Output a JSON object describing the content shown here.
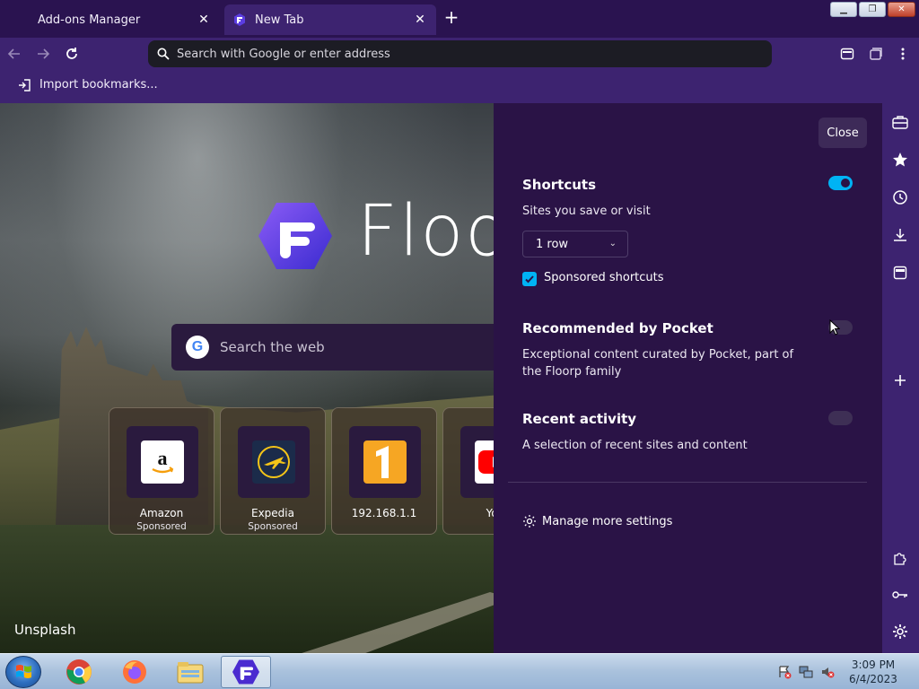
{
  "tabs": [
    {
      "label": "Add-ons Manager",
      "active": false
    },
    {
      "label": "New Tab",
      "active": true
    }
  ],
  "window_controls": {
    "minimize": "minimize-icon",
    "maximize": "restore-icon",
    "close": "close-icon"
  },
  "navbar": {
    "url_placeholder": "Search with Google or enter address"
  },
  "bookmarks": {
    "import_label": "Import bookmarks..."
  },
  "newtab": {
    "brand": "Floorp",
    "search_placeholder": "Search the web",
    "shortcuts": [
      {
        "title": "Amazon",
        "sub": "Sponsored",
        "icon": "amazon-icon",
        "color": "#ffffff"
      },
      {
        "title": "Expedia",
        "sub": "Sponsored",
        "icon": "expedia-icon",
        "color": "#1b2b4a"
      },
      {
        "title": "192.168.1.1",
        "sub": "",
        "icon": "number-one-icon",
        "color": "#f6a623"
      },
      {
        "title": "You",
        "sub": "",
        "icon": "youtube-icon",
        "color": "#ff0000"
      }
    ],
    "photo_credit": "Unsplash"
  },
  "panel": {
    "close_label": "Close",
    "shortcuts": {
      "title": "Shortcuts",
      "desc": "Sites you save or visit",
      "enabled": true,
      "rows_selected": "1 row",
      "sponsored_label": "Sponsored shortcuts",
      "sponsored_checked": true
    },
    "pocket": {
      "title": "Recommended by Pocket",
      "desc": "Exceptional content curated by Pocket, part of the Floorp family",
      "enabled": false
    },
    "recent": {
      "title": "Recent activity",
      "desc": "A selection of recent sites and content",
      "enabled": false
    },
    "manage_label": "Manage more settings"
  },
  "taskbar": {
    "time": "3:09 PM",
    "date": "6/4/2023"
  },
  "colors": {
    "accent": "#00b3f4",
    "panel_bg": "#2a1346",
    "toolbar_bg": "#3d2370"
  }
}
